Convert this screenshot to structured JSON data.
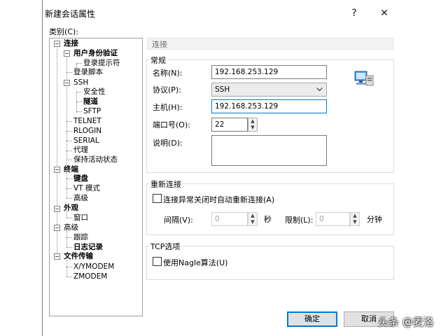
{
  "window": {
    "title": "新建会话属性",
    "help_label": "?",
    "close_label": "✕"
  },
  "category_label": "类别(C):",
  "tree": [
    {
      "id": "conn",
      "label": "连接",
      "bold": true,
      "toggle": "−"
    },
    {
      "id": "auth",
      "label": "用户身份验证",
      "bold": true,
      "toggle": "−"
    },
    {
      "id": "login-prompt",
      "label": "登录提示符",
      "bold": false
    },
    {
      "id": "login-script",
      "label": "登录脚本",
      "bold": false
    },
    {
      "id": "ssh",
      "label": "SSH",
      "bold": false,
      "toggle": "−"
    },
    {
      "id": "security",
      "label": "安全性",
      "bold": false
    },
    {
      "id": "tunnel",
      "label": "隧道",
      "bold": true
    },
    {
      "id": "sftp",
      "label": "SFTP",
      "bold": false
    },
    {
      "id": "telnet",
      "label": "TELNET",
      "bold": false
    },
    {
      "id": "rlogin",
      "label": "RLOGIN",
      "bold": false
    },
    {
      "id": "serial",
      "label": "SERIAL",
      "bold": false
    },
    {
      "id": "proxy",
      "label": "代理",
      "bold": false
    },
    {
      "id": "keepalive",
      "label": "保持活动状态",
      "bold": false
    },
    {
      "id": "terminal",
      "label": "终端",
      "bold": true,
      "toggle": "−"
    },
    {
      "id": "keyboard",
      "label": "键盘",
      "bold": true
    },
    {
      "id": "vt-mode",
      "label": "VT 模式",
      "bold": false
    },
    {
      "id": "term-advanced",
      "label": "高级",
      "bold": false
    },
    {
      "id": "appearance",
      "label": "外观",
      "bold": true,
      "toggle": "−"
    },
    {
      "id": "window",
      "label": "窗口",
      "bold": false
    },
    {
      "id": "advanced",
      "label": "高级",
      "bold": false,
      "toggle": "−"
    },
    {
      "id": "trace",
      "label": "跟踪",
      "bold": false
    },
    {
      "id": "logging",
      "label": "日志记录",
      "bold": true
    },
    {
      "id": "file-transfer",
      "label": "文件传输",
      "bold": true,
      "toggle": "−"
    },
    {
      "id": "xymodem",
      "label": "X/YMODEM",
      "bold": false
    },
    {
      "id": "zmodem",
      "label": "ZMODEM",
      "bold": false
    }
  ],
  "panel": {
    "header": "连接",
    "general": {
      "title": "常规",
      "name_label": "名称(N):",
      "name_value": "192.168.253.129",
      "protocol_label": "协议(P):",
      "protocol_value": "SSH",
      "host_label": "主机(H):",
      "host_value": "192.168.253.129",
      "port_label": "端口号(O):",
      "port_value": "22",
      "desc_label": "说明(D):",
      "desc_value": ""
    },
    "reconnect": {
      "title": "重新连接",
      "checkbox_label": "连接异常关闭时自动重新连接(A)",
      "interval_label": "间隔(V):",
      "interval_value": "0",
      "seconds_label": "秒",
      "limit_label": "限制(L):",
      "limit_value": "0",
      "minutes_label": "分钟"
    },
    "tcp": {
      "title": "TCP选项",
      "nagle_label": "使用Nagle算法(U)"
    }
  },
  "buttons": {
    "ok": "确定",
    "cancel": "取消"
  },
  "watermark": "头条 @麦洛"
}
